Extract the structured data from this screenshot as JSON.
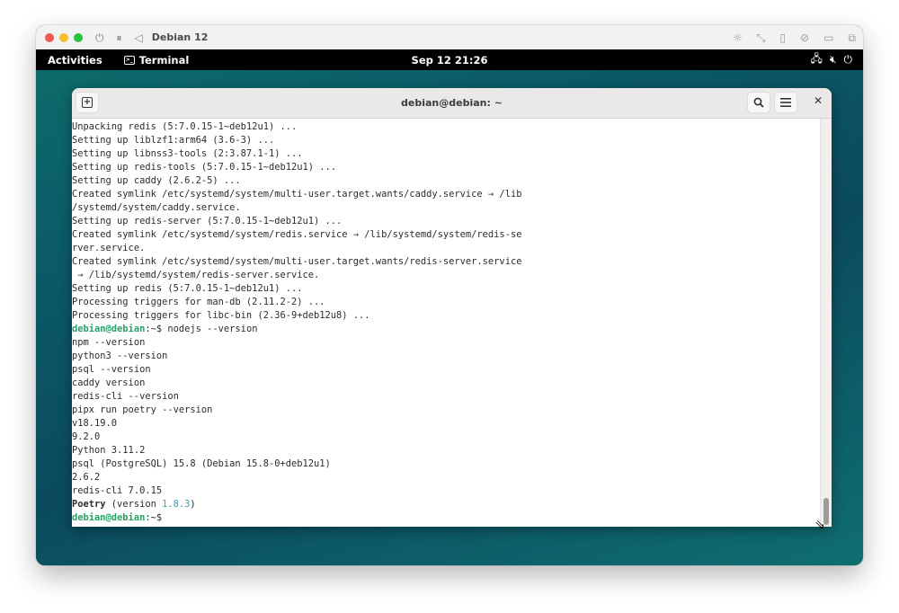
{
  "vm": {
    "title": "Debian 12",
    "controls": [
      "power-icon",
      "pause-icon",
      "back-icon"
    ],
    "right_icons": [
      "brightness-icon",
      "resize-icon",
      "usb-icon",
      "no-network-icon",
      "folder-icon",
      "windows-icon"
    ]
  },
  "gnome": {
    "activities": "Activities",
    "app_menu": "Terminal",
    "clock": "Sep 12  21:26",
    "tray": [
      "network-icon",
      "volume-muted-icon",
      "power-icon"
    ]
  },
  "terminal": {
    "title": "debian@debian: ~",
    "scroll_position": 1.0,
    "lines": [
      {
        "segments": [
          {
            "text": "Unpacking redis (5:7.0.15-1~deb12u1) ..."
          }
        ]
      },
      {
        "segments": [
          {
            "text": "Setting up liblzf1:arm64 (3.6-3) ..."
          }
        ]
      },
      {
        "segments": [
          {
            "text": "Setting up libnss3-tools (2:3.87.1-1) ..."
          }
        ]
      },
      {
        "segments": [
          {
            "text": "Setting up redis-tools (5:7.0.15-1~deb12u1) ..."
          }
        ]
      },
      {
        "segments": [
          {
            "text": "Setting up caddy (2.6.2-5) ..."
          }
        ]
      },
      {
        "segments": [
          {
            "text": "Created symlink /etc/systemd/system/multi-user.target.wants/caddy.service → /lib"
          }
        ]
      },
      {
        "segments": [
          {
            "text": "/systemd/system/caddy.service."
          }
        ]
      },
      {
        "segments": [
          {
            "text": "Setting up redis-server (5:7.0.15-1~deb12u1) ..."
          }
        ]
      },
      {
        "segments": [
          {
            "text": "Created symlink /etc/systemd/system/redis.service → /lib/systemd/system/redis-se"
          }
        ]
      },
      {
        "segments": [
          {
            "text": "rver.service."
          }
        ]
      },
      {
        "segments": [
          {
            "text": "Created symlink /etc/systemd/system/multi-user.target.wants/redis-server.service"
          }
        ]
      },
      {
        "segments": [
          {
            "text": " → /lib/systemd/system/redis-server.service."
          }
        ]
      },
      {
        "segments": [
          {
            "text": "Setting up redis (5:7.0.15-1~deb12u1) ..."
          }
        ]
      },
      {
        "segments": [
          {
            "text": "Processing triggers for man-db (2.11.2-2) ..."
          }
        ]
      },
      {
        "segments": [
          {
            "text": "Processing triggers for libc-bin (2.36-9+deb12u8) ..."
          }
        ]
      },
      {
        "segments": [
          {
            "text": "debian@debian",
            "style": "prompt-user"
          },
          {
            "text": ":~$ ",
            "style": "prompt-path"
          },
          {
            "text": "nodejs --version"
          }
        ]
      },
      {
        "segments": [
          {
            "text": "npm --version"
          }
        ]
      },
      {
        "segments": [
          {
            "text": "python3 --version"
          }
        ]
      },
      {
        "segments": [
          {
            "text": "psql --version"
          }
        ]
      },
      {
        "segments": [
          {
            "text": "caddy version"
          }
        ]
      },
      {
        "segments": [
          {
            "text": "redis-cli --version"
          }
        ]
      },
      {
        "segments": [
          {
            "text": "pipx run poetry --version"
          }
        ]
      },
      {
        "segments": [
          {
            "text": "v18.19.0"
          }
        ]
      },
      {
        "segments": [
          {
            "text": "9.2.0"
          }
        ]
      },
      {
        "segments": [
          {
            "text": "Python 3.11.2"
          }
        ]
      },
      {
        "segments": [
          {
            "text": "psql (PostgreSQL) 15.8 (Debian 15.8-0+deb12u1)"
          }
        ]
      },
      {
        "segments": [
          {
            "text": "2.6.2"
          }
        ]
      },
      {
        "segments": [
          {
            "text": "redis-cli 7.0.15"
          }
        ]
      },
      {
        "segments": [
          {
            "text": "Poetry",
            "style": "bold"
          },
          {
            "text": " (version "
          },
          {
            "text": "1.8.3",
            "style": "ver"
          },
          {
            "text": ")"
          }
        ]
      },
      {
        "segments": [
          {
            "text": "debian@debian",
            "style": "prompt-user"
          },
          {
            "text": ":~$",
            "style": "prompt-path"
          }
        ]
      }
    ]
  }
}
